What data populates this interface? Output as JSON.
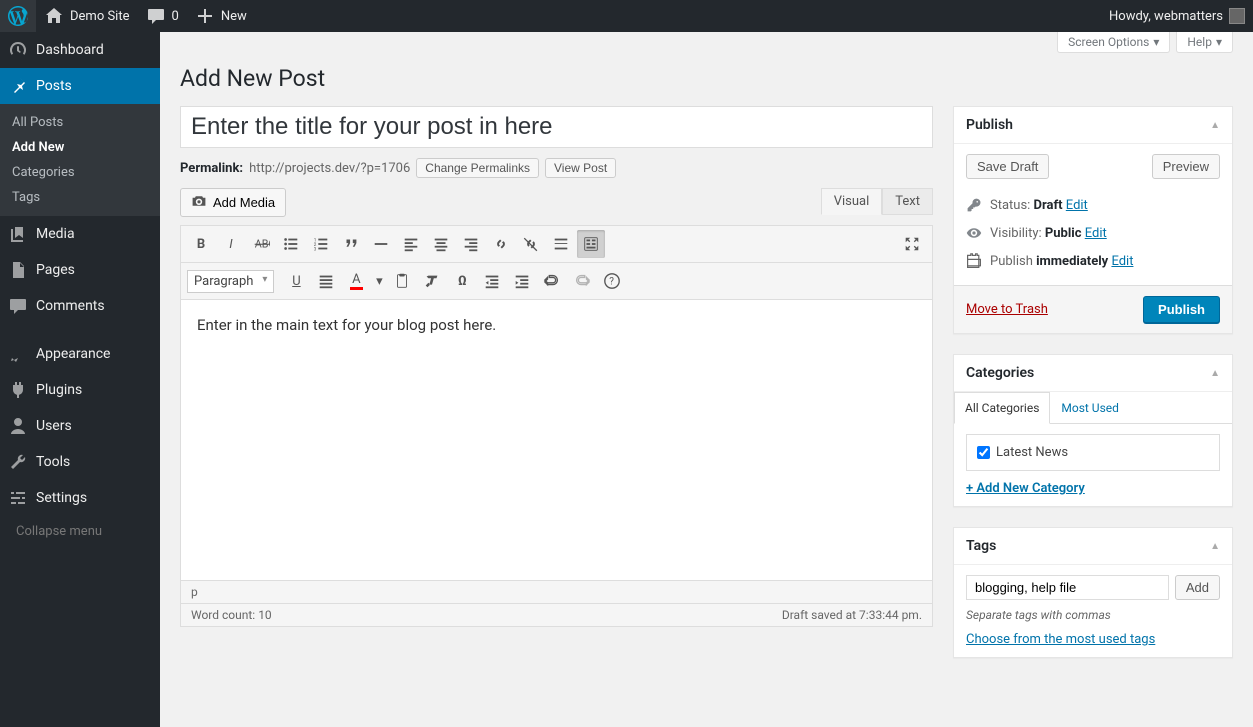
{
  "adminbar": {
    "site_name": "Demo Site",
    "comments_count": "0",
    "new_label": "New",
    "howdy_prefix": "Howdy, ",
    "user_name": "webmatters"
  },
  "sidebar": {
    "items": [
      {
        "id": "dashboard",
        "label": "Dashboard"
      },
      {
        "id": "posts",
        "label": "Posts",
        "current": true,
        "sub": [
          {
            "label": "All Posts"
          },
          {
            "label": "Add New",
            "current": true
          },
          {
            "label": "Categories"
          },
          {
            "label": "Tags"
          }
        ]
      },
      {
        "id": "media",
        "label": "Media"
      },
      {
        "id": "pages",
        "label": "Pages"
      },
      {
        "id": "comments",
        "label": "Comments"
      },
      {
        "id": "appearance",
        "label": "Appearance"
      },
      {
        "id": "plugins",
        "label": "Plugins"
      },
      {
        "id": "users",
        "label": "Users"
      },
      {
        "id": "tools",
        "label": "Tools"
      },
      {
        "id": "settings",
        "label": "Settings"
      }
    ],
    "collapse_label": "Collapse menu"
  },
  "screen_tabs": {
    "screen_options": "Screen Options",
    "help": "Help"
  },
  "page_title": "Add New Post",
  "title_input": {
    "value": "Enter the title for your post in here"
  },
  "permalink": {
    "label": "Permalink:",
    "url": "http://projects.dev/?p=1706",
    "change_btn": "Change Permalinks",
    "view_btn": "View Post"
  },
  "editor": {
    "add_media": "Add Media",
    "tab_visual": "Visual",
    "tab_text": "Text",
    "format_select": "Paragraph",
    "body_text": "Enter in the main text for your blog post here.",
    "path": "p",
    "word_count_label": "Word count: ",
    "word_count": "10",
    "autosave": "Draft saved at 7:33:44 pm."
  },
  "publish_box": {
    "title": "Publish",
    "save_draft": "Save Draft",
    "preview": "Preview",
    "status_label": "Status: ",
    "status_value": "Draft",
    "visibility_label": "Visibility: ",
    "visibility_value": "Public",
    "publish_label": "Publish ",
    "publish_value": "immediately",
    "edit_link": "Edit",
    "trash": "Move to Trash",
    "submit": "Publish"
  },
  "categories_box": {
    "title": "Categories",
    "tab_all": "All Categories",
    "tab_most": "Most Used",
    "items": [
      {
        "label": "Latest News",
        "checked": true
      }
    ],
    "add_new": "+ Add New Category"
  },
  "tags_box": {
    "title": "Tags",
    "input_value": "blogging, help file",
    "add_btn": "Add",
    "hint": "Separate tags with commas",
    "choose_link": "Choose from the most used tags"
  }
}
